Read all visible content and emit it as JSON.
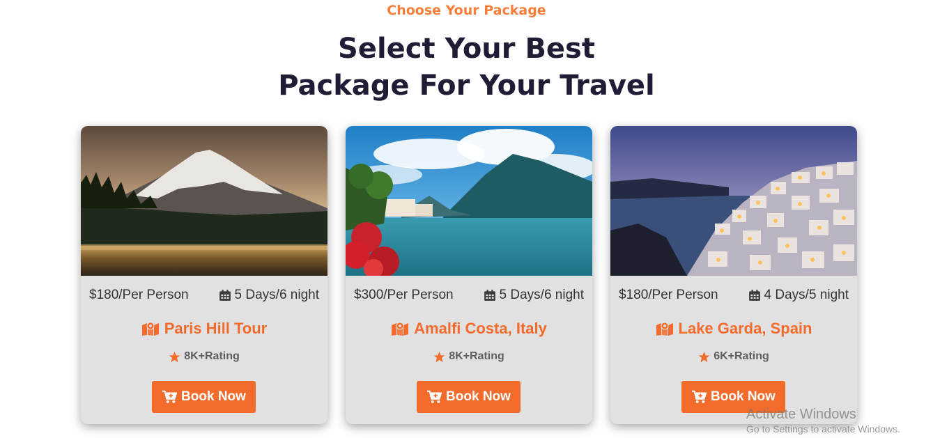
{
  "section": {
    "eyebrow": "Choose Your Package",
    "headline_line1": "Select Your Best",
    "headline_line2": "Package For Your Travel"
  },
  "colors": {
    "accent": "#f26b2b",
    "eyebrow": "#f47e3a",
    "heading": "#1f1d36",
    "card_bg": "#e1e1e1"
  },
  "icons": {
    "duration": "calendar-icon",
    "location": "map-icon",
    "rating": "star-icon",
    "button": "cart-plus-icon"
  },
  "packages": [
    {
      "price": "$180/Per Person",
      "duration": "5 Days/6 night",
      "title": "Paris Hill Tour",
      "rating": "8K+Rating",
      "button": "Book Now",
      "photo": "snow-capped mountain above lake at dusk"
    },
    {
      "price": "$300/Per Person",
      "duration": "5 Days/6 night",
      "title": "Amalfi Costa, Italy",
      "rating": "8K+Rating",
      "button": "Book Now",
      "photo": "turquoise lake with mountains and red flowers"
    },
    {
      "price": "$180/Per Person",
      "duration": "4 Days/5 night",
      "title": "Lake Garda, Spain",
      "rating": "6K+Rating",
      "button": "Book Now",
      "photo": "whitewashed cliffside village at twilight"
    }
  ],
  "watermark": {
    "line1": "Activate Windows",
    "line2": "Go to Settings to activate Windows."
  }
}
